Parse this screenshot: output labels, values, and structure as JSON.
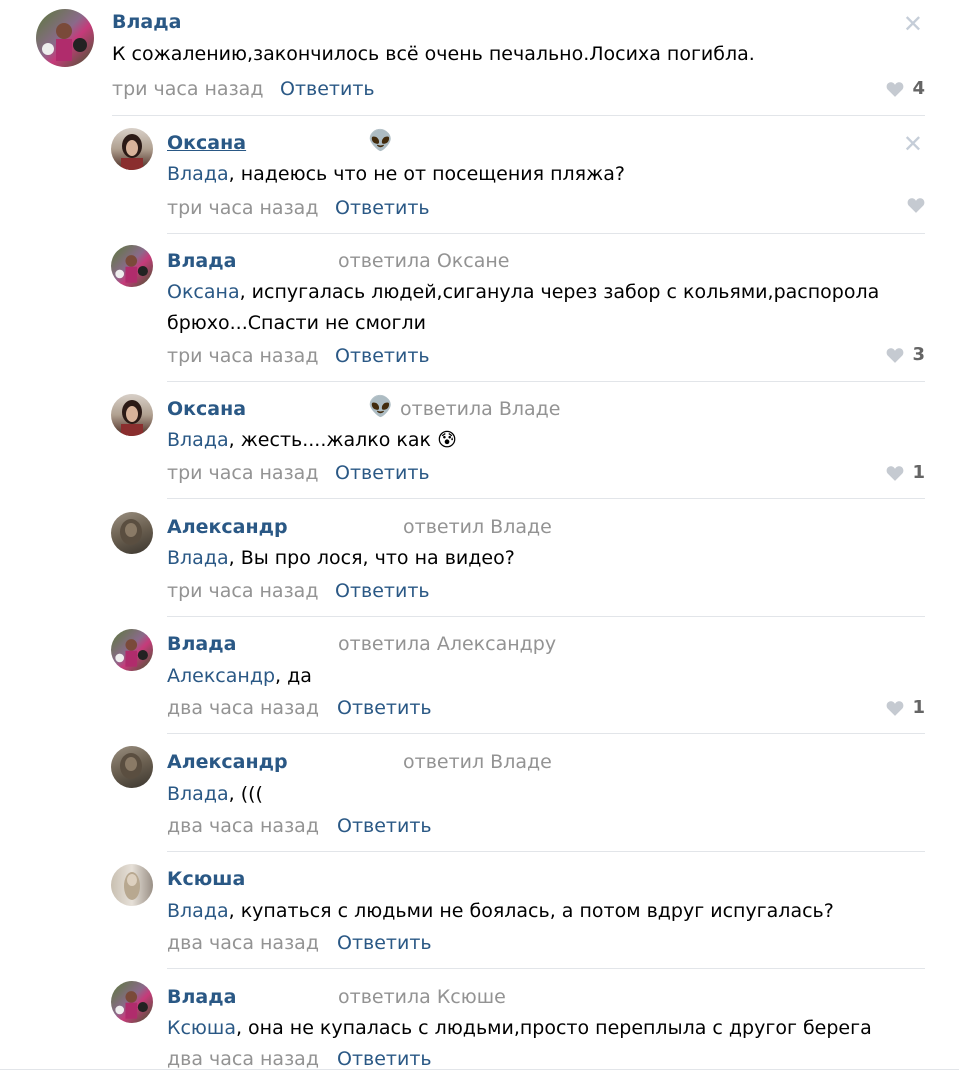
{
  "colors": {
    "link": "#2a5885",
    "muted": "#939393",
    "divider": "#e2e5e9"
  },
  "comments": [
    {
      "author": "Влада",
      "text": "К сожалению,закончилось всё очень печально.Лосиха погибла.",
      "time": "три часа назад",
      "reply": "Ответить",
      "likes": "4",
      "close": "✕"
    },
    {
      "author": "Оксана",
      "emoji": "👽",
      "mention": "Влада",
      "text": ", надеюсь что не от посещения пляжа?",
      "time": "три часа назад",
      "reply": "Ответить",
      "close": "✕"
    },
    {
      "author": "Влада",
      "replied_to": "ответила Оксане",
      "mention": "Оксана",
      "text": ", испугалась людей,сиганула через забор с кольями,распорола брюхо...Спасти не смогли",
      "time": "три часа назад",
      "reply": "Ответить",
      "likes": "3"
    },
    {
      "author": "Оксана",
      "emoji": "👽",
      "replied_to": "ответила Владе",
      "mention": "Влада",
      "text": ", жесть....жалко как",
      "text_emoji": "😰",
      "time": "три часа назад",
      "reply": "Ответить",
      "likes": "1"
    },
    {
      "author": "Александр",
      "replied_to": "ответил Владе",
      "mention": "Влада",
      "text": ", Вы про лося, что на видео?",
      "time": "три часа назад",
      "reply": "Ответить"
    },
    {
      "author": "Влада",
      "replied_to": "ответила Александру",
      "mention": "Александр",
      "text": ", да",
      "time": "два часа назад",
      "reply": "Ответить",
      "likes": "1"
    },
    {
      "author": "Александр",
      "replied_to": "ответил Владе",
      "mention": "Влада",
      "text": ", (((",
      "time": "два часа назад",
      "reply": "Ответить"
    },
    {
      "author": "Ксюша",
      "mention": "Влада",
      "text": ", купаться с людьми не боялась, а потом вдруг испугалась?",
      "time": "два часа назад",
      "reply": "Ответить"
    },
    {
      "author": "Влада",
      "replied_to": "ответила Ксюше",
      "mention": "Ксюша",
      "text": ", она не купалась с людьми,просто переплыла с другог берега",
      "time": "два часа назад",
      "reply": "Ответить"
    }
  ]
}
